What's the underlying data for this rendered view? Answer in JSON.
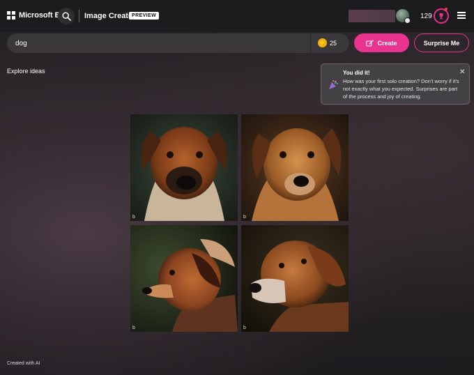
{
  "header": {
    "brand": "Microsoft Bing",
    "app_title": "Image Creator",
    "badge": "PREVIEW",
    "rewards_count": "129",
    "icons": [
      "windows-logo-icon",
      "search-icon",
      "avatar",
      "trophy-icon",
      "hamburger-menu-icon"
    ]
  },
  "prompt": {
    "value": "dog",
    "boosts": "25",
    "create_label": "Create",
    "surprise_label": "Surprise Me"
  },
  "explore_label": "Explore ideas",
  "toast": {
    "title": "You did it!",
    "body": "How was your first solo creation? Don't worry if it's not exactly what you expected. Surprises are part of the process and joy of creating."
  },
  "images": [
    {
      "subject": "dog portrait, front-facing",
      "watermark": "b"
    },
    {
      "subject": "dog portrait, head tilted",
      "watermark": "b"
    },
    {
      "subject": "dog profile facing left",
      "watermark": "b"
    },
    {
      "subject": "older dog portrait",
      "watermark": "b"
    }
  ],
  "footer": "Created with AI",
  "colors": {
    "accent": "#e8338f",
    "topbar": "#1c1b1d",
    "boost": "#f1b00c"
  }
}
